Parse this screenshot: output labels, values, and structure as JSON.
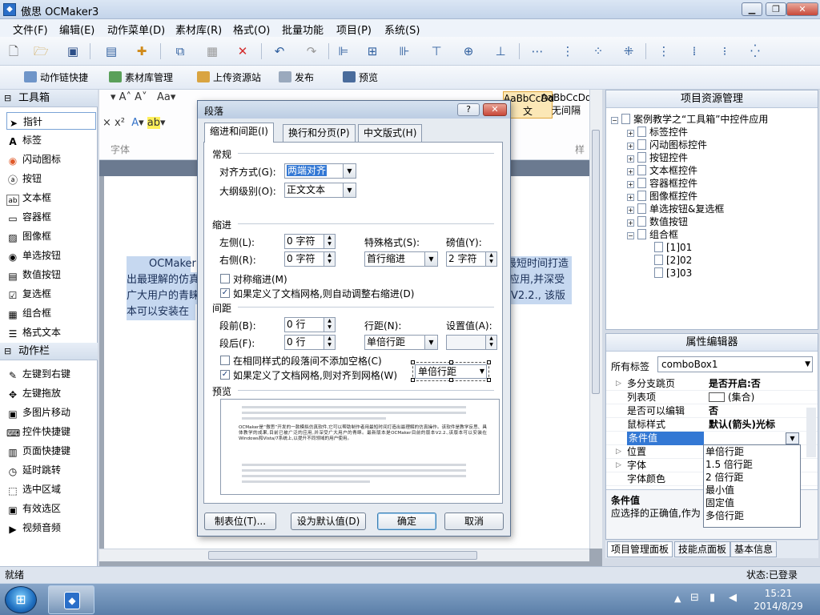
{
  "window": {
    "title": "傲思 OCMaker3",
    "app_icon": "app-icon"
  },
  "menu": [
    "文件(F)",
    "编辑(E)",
    "动作菜单(D)",
    "素材库(R)",
    "格式(O)",
    "批量功能",
    "项目(P)",
    "系统(S)"
  ],
  "toolbar2": [
    "动作链快捷",
    "素材库管理",
    "上传资源站",
    "发布",
    "预览"
  ],
  "toolbox": {
    "header1": "工具箱",
    "items": [
      "指针",
      "标签",
      "闪动图标",
      "按钮",
      "文本框",
      "容器框",
      "图像框",
      "单选按钮",
      "数值按钮",
      "复选框",
      "组合框",
      "格式文本"
    ],
    "header2": "动作栏",
    "actions": [
      "左键到右键",
      "左键拖放",
      "多图片移动",
      "控件快捷键",
      "页面快捷键",
      "延时跳转",
      "选中区域",
      "有效选区",
      "视频音频"
    ]
  },
  "document": {
    "style_samples": [
      "AaBbCcDd",
      "AaBbCcDd"
    ],
    "style_caption": "字体",
    "style_tail": "文",
    "style_nospacing": "无间隔",
    "style_more": "样",
    "lines": [
      "OCMaker",
      "出最理解的仿真",
      "广大用户的青睐",
      "本可以安装在"
    ],
    "lines_right": [
      "最短时间打造",
      "应用,并深受",
      "V2.2., 该版"
    ]
  },
  "project_panel": {
    "title": "项目资源管理",
    "root": "案例教学之“工具箱”中控件应用",
    "nodes": [
      "标签控件",
      "闪动图标控件",
      "按钮控件",
      "文本框控件",
      "容器框控件",
      "图像框控件",
      "单选按钮&复选框",
      "数值按钮",
      "组合框"
    ],
    "children": [
      "[1]01",
      "[2]02",
      "[3]03"
    ]
  },
  "property_editor": {
    "title": "属性编辑器",
    "label": "所有标签",
    "combo_value": "comboBox1",
    "rows": [
      {
        "name": "多分支跳页",
        "value": "是否开启:否"
      },
      {
        "name": "列表项",
        "value": "(集合)"
      },
      {
        "name": "是否可以编辑",
        "value": "否"
      },
      {
        "name": "鼠标样式",
        "value": "默认(箭头)光标"
      },
      {
        "name": "条件值",
        "value": ""
      },
      {
        "name": "位置",
        "value": ""
      },
      {
        "name": "字体",
        "value": ""
      },
      {
        "name": "字体颜色",
        "value": ""
      }
    ],
    "dropdown_options": [
      "单倍行距",
      "1.5 倍行距",
      "2 倍行距",
      "最小值",
      "固定值",
      "多倍行距"
    ],
    "desc_title": "条件值",
    "desc_text": "应选择的正确值,作为",
    "tabs": [
      "项目管理面板",
      "技能点面板",
      "基本信息"
    ]
  },
  "status": {
    "left": "就绪",
    "right": "状态:已登录"
  },
  "taskbar": {
    "time": "15:21",
    "date": "2014/8/29"
  },
  "dialog": {
    "title": "段落",
    "help": "?",
    "close": "✕",
    "tabs": [
      "缩进和间距(I)",
      "换行和分页(P)",
      "中文版式(H)"
    ],
    "section_general": "常规",
    "align_label": "对齐方式(G):",
    "align_value": "两端对齐",
    "outline_label": "大纲级别(O):",
    "outline_value": "正文文本",
    "section_indent": "缩进",
    "left_label": "左侧(L):",
    "left_value": "0 字符",
    "right_label": "右侧(R):",
    "right_value": "0 字符",
    "special_label": "特殊格式(S):",
    "special_value": "首行缩进",
    "measure_label": "磅值(Y):",
    "measure_value": "2 字符",
    "mirror": "对称缩进(M)",
    "auto_adjust": "如果定义了文档网格,则自动调整右缩进(D)",
    "section_spacing": "间距",
    "before_label": "段前(B):",
    "before_value": "0 行",
    "after_label": "段后(F):",
    "after_value": "0 行",
    "line_label": "行距(N):",
    "line_value": "单倍行距",
    "setval_label": "设置值(A):",
    "no_space": "在相同样式的段落间不添加空格(C)",
    "snap_grid": "如果定义了文档网格,则对齐到网格(W)",
    "overlay_combo": "单倍行距",
    "section_preview": "预览",
    "preview_text": "OCMaker是“傲思”开发的一款模拟仿真软件,它可以帮助制作者用最短时间打造出最理解的仿真操作。该软件是教学反思、具体教学的成果,目前已被广泛的应用,并深受广大用户的青睐。最新版本是OCMaker目前的版本V2.2.,该版本可以安装在Windows和Vista/7系统上,以提升不同领域的用户使用。",
    "btn_tabs": "制表位(T)...",
    "btn_default": "设为默认值(D)",
    "btn_ok": "确定",
    "btn_cancel": "取消"
  }
}
